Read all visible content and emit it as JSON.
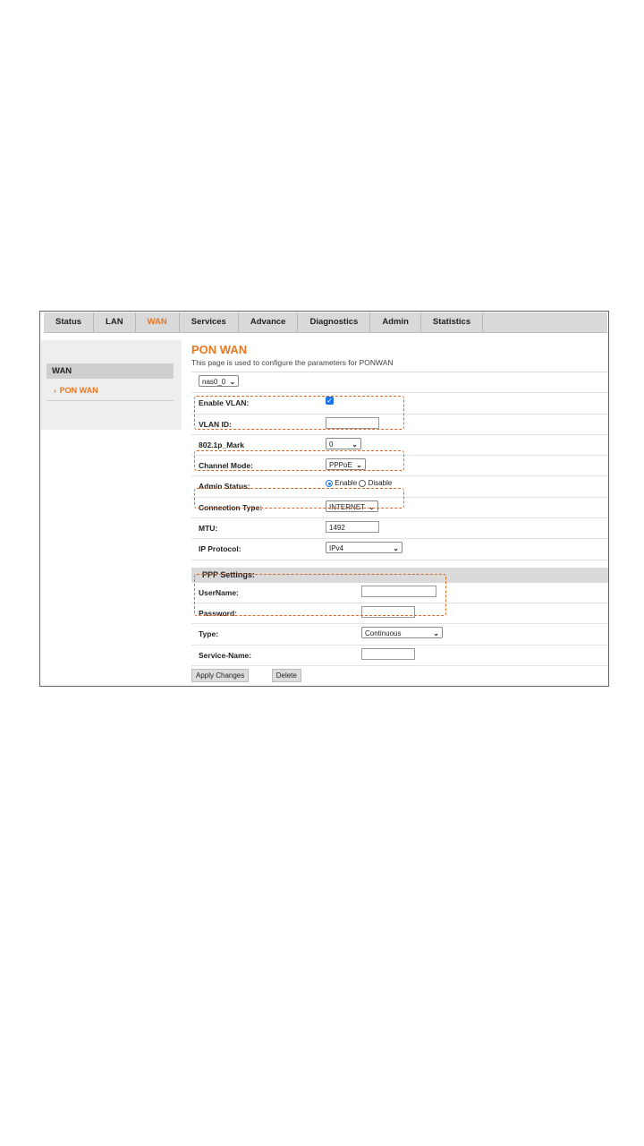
{
  "nav": {
    "tabs": [
      "Status",
      "LAN",
      "WAN",
      "Services",
      "Advance",
      "Diagnostics",
      "Admin",
      "Statistics"
    ],
    "active": "WAN"
  },
  "sidebar": {
    "group": "WAN",
    "item": "PON WAN"
  },
  "page": {
    "title": "PON WAN",
    "description": "This page is used to configure the parameters for PONWAN"
  },
  "form": {
    "interface_select": "nas0_0",
    "enable_vlan": {
      "label": "Enable VLAN:",
      "checked": true
    },
    "vlan_id": {
      "label": "VLAN ID:",
      "value": ""
    },
    "mark_8021p": {
      "label": "802.1p_Mark",
      "value": "0"
    },
    "channel_mode": {
      "label": "Channel Mode:",
      "value": "PPPoE"
    },
    "admin_status": {
      "label": "Admin Status:",
      "enable": "Enable",
      "disable": "Disable",
      "selected": "Enable"
    },
    "connection_type": {
      "label": "Connection Type:",
      "value": "INTERNET"
    },
    "mtu": {
      "label": "MTU:",
      "value": "1492"
    },
    "ip_protocol": {
      "label": "IP Protocol:",
      "value": "IPv4"
    }
  },
  "ppp": {
    "header": "PPP Settings:",
    "username": {
      "label": "UserName:",
      "value": ""
    },
    "password": {
      "label": "Password:",
      "value": ""
    },
    "type": {
      "label": "Type:",
      "value": "Continuous"
    },
    "service_name": {
      "label": "Service-Name:",
      "value": ""
    }
  },
  "buttons": {
    "apply": "Apply Changes",
    "delete": "Delete"
  },
  "colors": {
    "accent": "#e87722",
    "highlight": "#d9692a",
    "checkbox": "#1a73e8"
  }
}
